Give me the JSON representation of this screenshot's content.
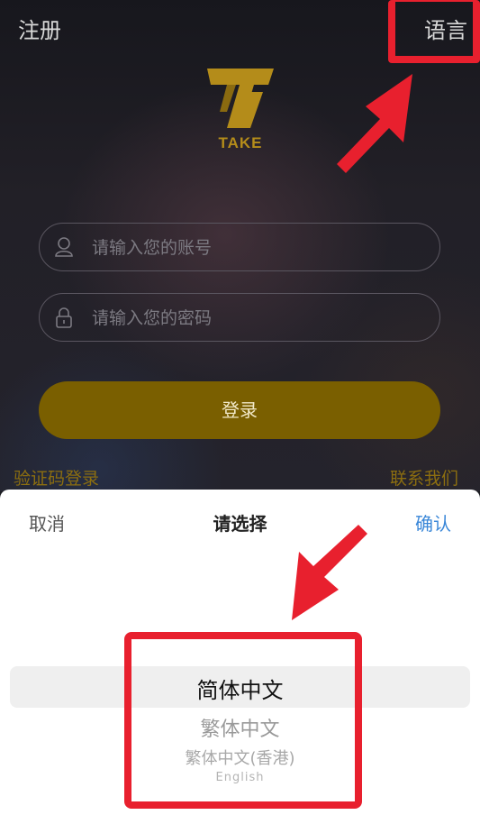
{
  "header": {
    "register_label": "注册",
    "language_label": "语言"
  },
  "logo": {
    "text": "TAKE",
    "color": "#b48c1a"
  },
  "form": {
    "account_placeholder": "请输入您的账号",
    "password_placeholder": "请输入您的密码",
    "login_label": "登录",
    "code_login_label": "验证码登录",
    "contact_label": "联系我们",
    "accent_color": "#7a5f00"
  },
  "picker": {
    "cancel_label": "取消",
    "title": "请选择",
    "confirm_label": "确认",
    "options": [
      "简体中文",
      "繁体中文",
      "繁体中文(香港)",
      "English"
    ],
    "selected": "简体中文",
    "confirm_color": "#3a87d8"
  },
  "annotations": {
    "highlight_color": "#e8202e",
    "icons": [
      "arrow-icon",
      "arrow-icon"
    ]
  }
}
